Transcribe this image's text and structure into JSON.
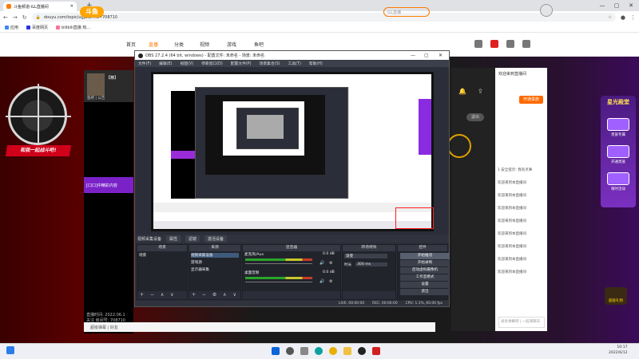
{
  "browser": {
    "tab_title": "斗鱼频道-iLL直播间",
    "address": "douyu.com/topic/ugj2sz?rid=708710",
    "bookmarks": [
      "应用",
      "百度网页",
      "bilibili直播 热..."
    ]
  },
  "site": {
    "logo": "斗鱼",
    "nav": [
      "首页",
      "直播",
      "分类",
      "视频",
      "游戏",
      "鱼吧"
    ],
    "search_placeholder": "iLL直播"
  },
  "page": {
    "slogan": "和我一起战斗吧!",
    "side_banner": "[口口]中精彩内容",
    "streamer_name": "【精】",
    "streamer_meta": "鱼吧 | 公告",
    "stats_1": "直播时间: 2022.06.1",
    "stats_2": "关注 房间号: 708710",
    "chat_footer": "超级弹幕 | 好友",
    "chat_panel_title": "欢迎来到直播间",
    "follow_label": "开通贵族",
    "exit_label": "退出",
    "chat_lines": [
      "1 安全提示: 我有点事",
      "欢迎来到本直播间",
      "欢迎来到本直播间",
      "欢迎来到本直播间",
      "欢迎来到本直播间",
      "欢迎来到本直播间",
      "欢迎来到本直播间",
      "欢迎来到本直播间",
      "欢迎来到本直播间"
    ],
    "chat_input_placeholder": "发条弹幕吧 | 一起来聊天",
    "promo_title": "星光殿堂",
    "promo_items": [
      "贵族专属",
      "开通贵族",
      "限时活动"
    ],
    "gift_label": "超级礼物"
  },
  "obs": {
    "title": "OBS 27.2.4 (64 bit, windows) - 配置文件: 未命名 - 场景: 未命名",
    "menu": [
      "文件(F)",
      "编辑(E)",
      "视图(V)",
      "停靠窗口(D)",
      "配置文件(P)",
      "场景集合(S)",
      "工具(T)",
      "帮助(H)"
    ],
    "tabbar": [
      "视频采集设备",
      "属性",
      "滤镜",
      "激活设备"
    ],
    "docks": {
      "scenes": {
        "title": "场景",
        "items": [
          "场景"
        ]
      },
      "sources": {
        "title": "来源",
        "items": [
          "视频采集设备",
          "游戏源",
          "显示器采集"
        ]
      },
      "mixer": {
        "title": "混音器",
        "channels": [
          {
            "name": "桌面音频",
            "db": "0.0 dB"
          },
          {
            "name": "麦克风/Aux",
            "db": "0.0 dB"
          }
        ]
      },
      "transitions": {
        "title": "转场特效",
        "type": "渐变",
        "duration_label": "时长",
        "duration_value": "300 ms"
      },
      "controls": {
        "title": "控件",
        "buttons": [
          "开始推流",
          "开始录制",
          "启动虚拟摄像机",
          "工作室模式",
          "设置",
          "退出"
        ]
      }
    },
    "status": [
      "LIVE: 00:00:00",
      "REC: 00:00:00",
      "CPU: 1.1%, 60.00 fps"
    ]
  },
  "taskbar": {
    "time": "10:17",
    "date": "2022/6/12"
  }
}
